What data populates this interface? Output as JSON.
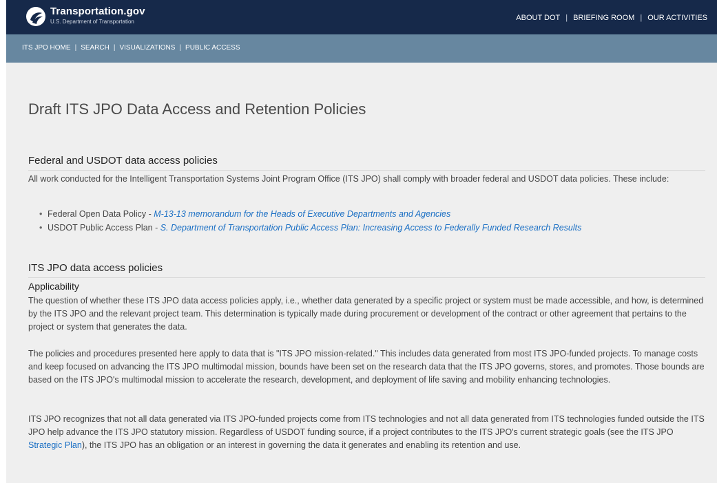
{
  "header": {
    "brand_title": "Transportation.gov",
    "brand_subtitle": "U.S. Department of Transportation",
    "logo_icon": "dot-logo-icon",
    "nav": [
      "ABOUT DOT",
      "BRIEFING ROOM",
      "OUR ACTIVITIES"
    ],
    "separator": "|"
  },
  "subnav": {
    "links": [
      "ITS JPO HOME",
      "SEARCH",
      "VISUALIZATIONS",
      "PUBLIC ACCESS"
    ],
    "separator": "|"
  },
  "main": {
    "title": "Draft ITS JPO Data Access and Retention Policies",
    "section1": {
      "heading": "Federal and USDOT data access policies",
      "intro": "All work conducted for the Intelligent Transportation Systems Joint Program Office (ITS JPO) shall comply with broader federal and USDOT data policies. These include:",
      "bullets": [
        {
          "label": "Federal Open Data Policy - ",
          "link": "M-13-13 memorandum for the Heads of Executive Departments and Agencies"
        },
        {
          "label": "USDOT Public Access Plan - ",
          "link": "S. Department of Transportation Public Access Plan: Increasing Access to Federally Funded Research Results"
        }
      ]
    },
    "section2": {
      "heading": "ITS JPO data access policies",
      "subheading": "Applicability",
      "para1": "The question of whether these ITS JPO data access policies apply, i.e., whether data generated by a specific project or system must be made accessible, and how, is determined by the ITS JPO and the relevant project team. This determination is typically made during procurement or development of the contract or other agreement that pertains to the project or system that generates the data.",
      "para2": "The policies and procedures presented here apply to data that is \"ITS JPO mission-related.\" This includes data generated from most ITS JPO-funded projects. To manage costs and keep focused on advancing the ITS JPO multimodal mission, bounds have been set on the research data that the ITS JPO governs, stores, and promotes. Those bounds are based on the ITS JPO's multimodal mission to accelerate the research, development, and deployment of life saving and mobility enhancing technologies.",
      "para3_before": "ITS JPO recognizes that not all data generated via ITS JPO-funded projects come from ITS technologies and not all data generated from ITS technologies funded outside the ITS JPO help advance the ITS JPO statutory mission. Regardless of USDOT funding source, if a project contributes to the ITS JPO's current strategic goals (see the ITS JPO ",
      "para3_link": "Strategic Plan",
      "para3_after": "), the ITS JPO has an obligation or an interest in governing the data it generates and enabling its retention and use."
    }
  },
  "colors": {
    "topbar": "#16294a",
    "subnav": "#6787a0",
    "content_bg": "#efefef",
    "link": "#1a6fc4"
  }
}
